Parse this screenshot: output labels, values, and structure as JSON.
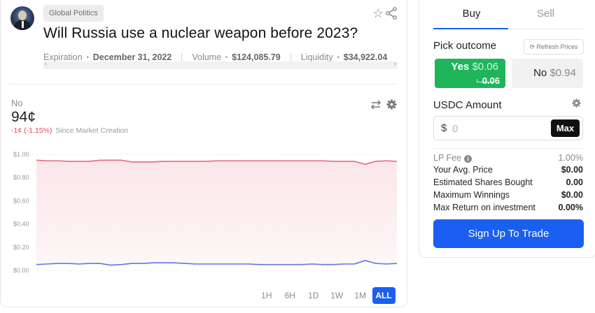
{
  "market": {
    "category": "Global Politics",
    "title": "Will Russia use a nuclear weapon before 2023?",
    "meta": [
      {
        "label": "Expiration",
        "value": "December 31, 2022"
      },
      {
        "label": "Volume",
        "value": "$124,085.79"
      },
      {
        "label": "Liquidity",
        "value": "$34,922.04"
      }
    ]
  },
  "outcome_summary": {
    "name": "No",
    "price": "94¢",
    "change": "-1¢",
    "change_pct": "(-1.15%)",
    "since": "Since Market Creation"
  },
  "chart_data": {
    "type": "line",
    "ylim": [
      0,
      1
    ],
    "yticks": [
      "$1.00",
      "$0.80",
      "$0.60",
      "$0.40",
      "$0.20",
      "$0.00"
    ],
    "grid": true,
    "series": [
      {
        "color": "#e36a7e",
        "values": [
          0.95,
          0.945,
          0.945,
          0.94,
          0.94,
          0.94,
          0.95,
          0.95,
          0.95,
          0.935,
          0.935,
          0.935,
          0.94,
          0.94,
          0.94,
          0.94,
          0.94,
          0.945,
          0.945,
          0.945,
          0.945,
          0.945,
          0.945,
          0.945,
          0.945,
          0.945,
          0.945,
          0.945,
          0.94,
          0.94,
          0.94,
          0.915,
          0.94,
          0.945,
          0.94
        ]
      },
      {
        "color": "#5b78e6",
        "values": [
          0.05,
          0.055,
          0.06,
          0.06,
          0.055,
          0.06,
          0.06,
          0.045,
          0.05,
          0.06,
          0.06,
          0.065,
          0.065,
          0.065,
          0.06,
          0.055,
          0.055,
          0.055,
          0.055,
          0.055,
          0.055,
          0.05,
          0.05,
          0.05,
          0.05,
          0.05,
          0.055,
          0.05,
          0.05,
          0.055,
          0.055,
          0.085,
          0.06,
          0.055,
          0.06
        ]
      }
    ]
  },
  "ranges": {
    "items": [
      "1H",
      "6H",
      "1D",
      "1W",
      "1M",
      "ALL"
    ],
    "active": "ALL"
  },
  "trade": {
    "tabs": {
      "buy": "Buy",
      "sell": "Sell"
    },
    "pick_label": "Pick outcome",
    "refresh_label": "Refresh Prices",
    "yes": {
      "label": "Yes",
      "price": "$0.06",
      "shares": "0.06"
    },
    "no": {
      "label": "No",
      "price": "$0.94"
    },
    "usdc_label": "USDC Amount",
    "currency_symbol": "$",
    "amount_placeholder": "0",
    "max_label": "Max",
    "stats": [
      {
        "label": "LP Fee",
        "value": "1.00%"
      },
      {
        "label": "Your Avg. Price",
        "value": "$0.00"
      },
      {
        "label": "Estimated Shares Bought",
        "value": "0.00"
      },
      {
        "label": "Maximum Winnings",
        "value": "$0.00"
      },
      {
        "label": "Max Return on investment",
        "value": "0.00%"
      }
    ],
    "signup_label": "Sign Up To Trade"
  }
}
